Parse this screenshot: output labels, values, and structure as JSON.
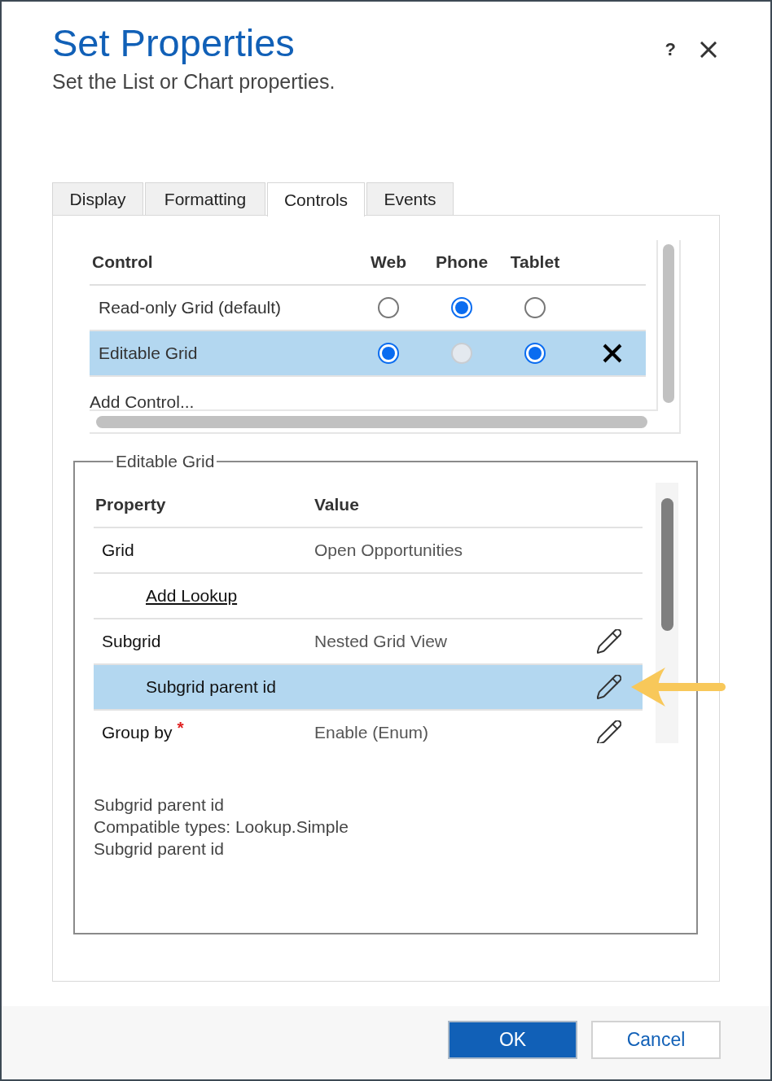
{
  "dialog": {
    "title": "Set Properties",
    "subtitle": "Set the List or Chart properties.",
    "help_label": "?"
  },
  "tabs": [
    {
      "label": "Display",
      "selected": false
    },
    {
      "label": "Formatting",
      "selected": false
    },
    {
      "label": "Controls",
      "selected": true
    },
    {
      "label": "Events",
      "selected": false
    }
  ],
  "controls_table": {
    "columns": [
      "Control",
      "Web",
      "Phone",
      "Tablet"
    ],
    "rows": [
      {
        "name": "Read-only Grid (default)",
        "selected": false,
        "removable": false,
        "options": [
          {
            "checked": false,
            "disabled": false
          },
          {
            "checked": true,
            "disabled": false
          },
          {
            "checked": false,
            "disabled": false
          }
        ]
      },
      {
        "name": "Editable Grid",
        "selected": true,
        "removable": true,
        "options": [
          {
            "checked": true,
            "disabled": false
          },
          {
            "checked": false,
            "disabled": true
          },
          {
            "checked": true,
            "disabled": false
          }
        ]
      }
    ],
    "add_link": "Add Control..."
  },
  "properties": {
    "legend": "Editable Grid",
    "columns": [
      "Property",
      "Value"
    ],
    "rows": [
      {
        "kind": "field",
        "property": "Grid",
        "value": "Open Opportunities",
        "selected": false,
        "editable": false
      },
      {
        "kind": "link",
        "label": "Add Lookup",
        "selected": false,
        "editable": false
      },
      {
        "kind": "field",
        "property": "Subgrid",
        "value": "Nested Grid View",
        "selected": false,
        "editable": true
      },
      {
        "kind": "subfield",
        "property": "Subgrid parent id",
        "selected": true,
        "editable": true
      },
      {
        "kind": "field",
        "property": "Group by",
        "required_mark": "*",
        "value": "Enable (Enum)",
        "selected": false,
        "editable": true
      }
    ],
    "description": [
      "Subgrid parent id",
      "Compatible types: Lookup.Simple",
      "Subgrid parent id"
    ]
  },
  "buttons": [
    {
      "label": "OK",
      "kind": "primary"
    },
    {
      "label": "Cancel",
      "kind": "secondary"
    }
  ]
}
